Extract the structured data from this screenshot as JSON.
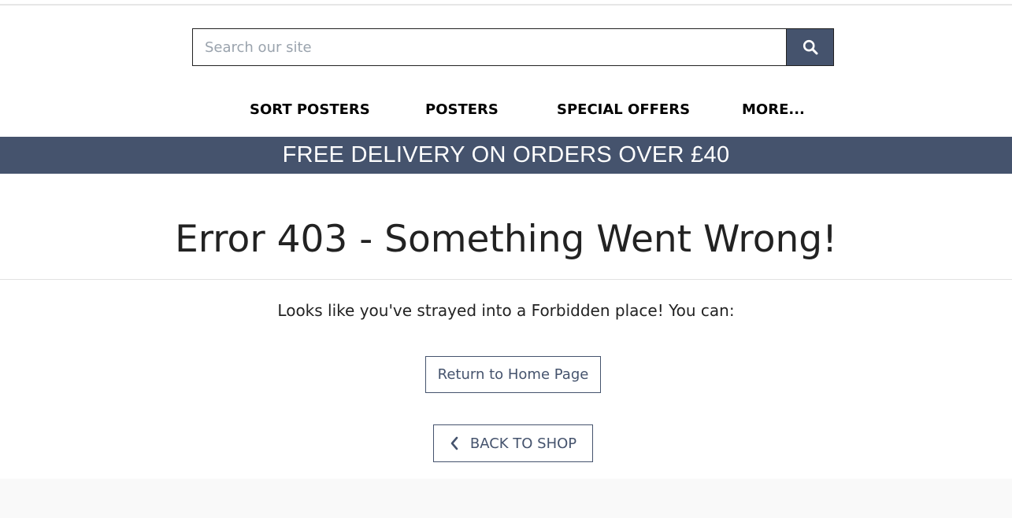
{
  "search": {
    "placeholder": "Search our site",
    "icon": "search-icon"
  },
  "nav": {
    "items": [
      {
        "label": "SORT POSTERS"
      },
      {
        "label": "POSTERS"
      },
      {
        "label": "SPECIAL OFFERS"
      },
      {
        "label": "MORE..."
      }
    ]
  },
  "banner": {
    "text": "FREE DELIVERY ON ORDERS OVER £40"
  },
  "main": {
    "title": "Error 403 - Something Went Wrong!",
    "message": "Looks like you've strayed into a Forbidden place! You can:",
    "home_button": "Return to Home Page",
    "back_button": "BACK TO SHOP",
    "back_icon": "chevron-left-icon"
  },
  "colors": {
    "brand": "#45536d",
    "text": "#222222",
    "background": "#ffffff",
    "footer_background": "#f9f9f9"
  }
}
